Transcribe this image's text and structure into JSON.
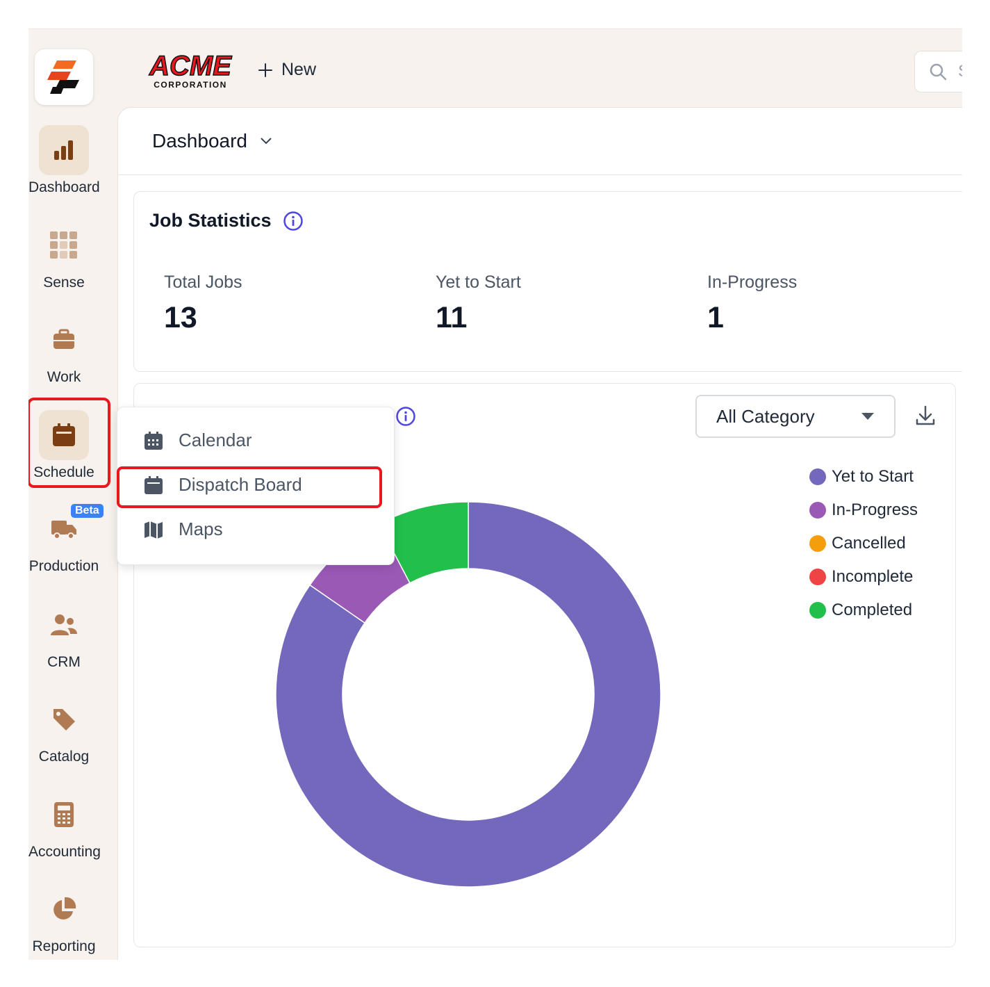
{
  "header": {
    "brand_name": "ACME",
    "brand_sub": "CORPORATION",
    "new_label": "New",
    "search_placeholder": "S"
  },
  "sidebar": {
    "items": [
      {
        "label": "Dashboard",
        "icon": "bar-chart-icon"
      },
      {
        "label": "Sense",
        "icon": "grid-icon"
      },
      {
        "label": "Work",
        "icon": "briefcase-icon"
      },
      {
        "label": "Schedule",
        "icon": "calendar-icon",
        "active": true
      },
      {
        "label": "Production",
        "icon": "truck-icon",
        "badge": "Beta"
      },
      {
        "label": "CRM",
        "icon": "users-icon"
      },
      {
        "label": "Catalog",
        "icon": "tag-icon"
      },
      {
        "label": "Accounting",
        "icon": "calculator-icon"
      },
      {
        "label": "Reporting",
        "icon": "pie-chart-icon"
      }
    ]
  },
  "page": {
    "title": "Dashboard"
  },
  "job_statistics": {
    "title": "Job Statistics",
    "stats": [
      {
        "label": "Total Jobs",
        "value": "13"
      },
      {
        "label": "Yet to Start",
        "value": "11"
      },
      {
        "label": "In-Progress",
        "value": "1"
      }
    ]
  },
  "chart_card": {
    "category_select": "All Category"
  },
  "dropdown": {
    "items": [
      {
        "label": "Calendar",
        "icon": "calendar-icon"
      },
      {
        "label": "Dispatch Board",
        "icon": "calendar-icon"
      },
      {
        "label": "Maps",
        "icon": "map-icon"
      }
    ]
  },
  "chart_data": {
    "type": "pie",
    "donut": true,
    "categories": [
      "Yet to Start",
      "In-Progress",
      "Cancelled",
      "Incomplete",
      "Completed"
    ],
    "values": [
      11,
      1,
      0,
      0,
      1
    ],
    "colors": [
      "#7468bd",
      "#9b59b6",
      "#f59e0b",
      "#ef4444",
      "#22c04b"
    ],
    "legend": "right"
  }
}
